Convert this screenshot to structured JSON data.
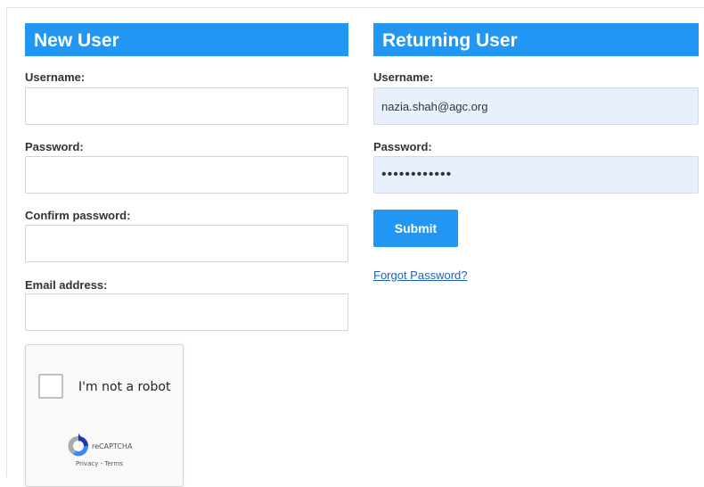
{
  "new_user": {
    "title": "New User",
    "username_label": "Username:",
    "username_value": "",
    "password_label": "Password:",
    "password_value": "",
    "confirm_label": "Confirm password:",
    "confirm_value": "",
    "email_label": "Email address:",
    "email_value": ""
  },
  "returning_user": {
    "title": "Returning User",
    "username_label": "Username:",
    "username_value": "nazia.shah@agc.org",
    "password_label": "Password:",
    "password_masked": "••••••••••••",
    "submit_label": "Submit",
    "forgot_label": "Forgot Password?"
  },
  "captcha": {
    "label": "I'm not a robot",
    "brand": "reCAPTCHA",
    "privacy": "Privacy",
    "separator": "-",
    "terms": "Terms",
    "checked": false
  },
  "colors": {
    "accent": "#2196f3",
    "autofill_bg": "#e8f0fe",
    "link": "#1e63b8"
  },
  "icons": {
    "captcha_logo": "recaptcha-logo-icon"
  }
}
